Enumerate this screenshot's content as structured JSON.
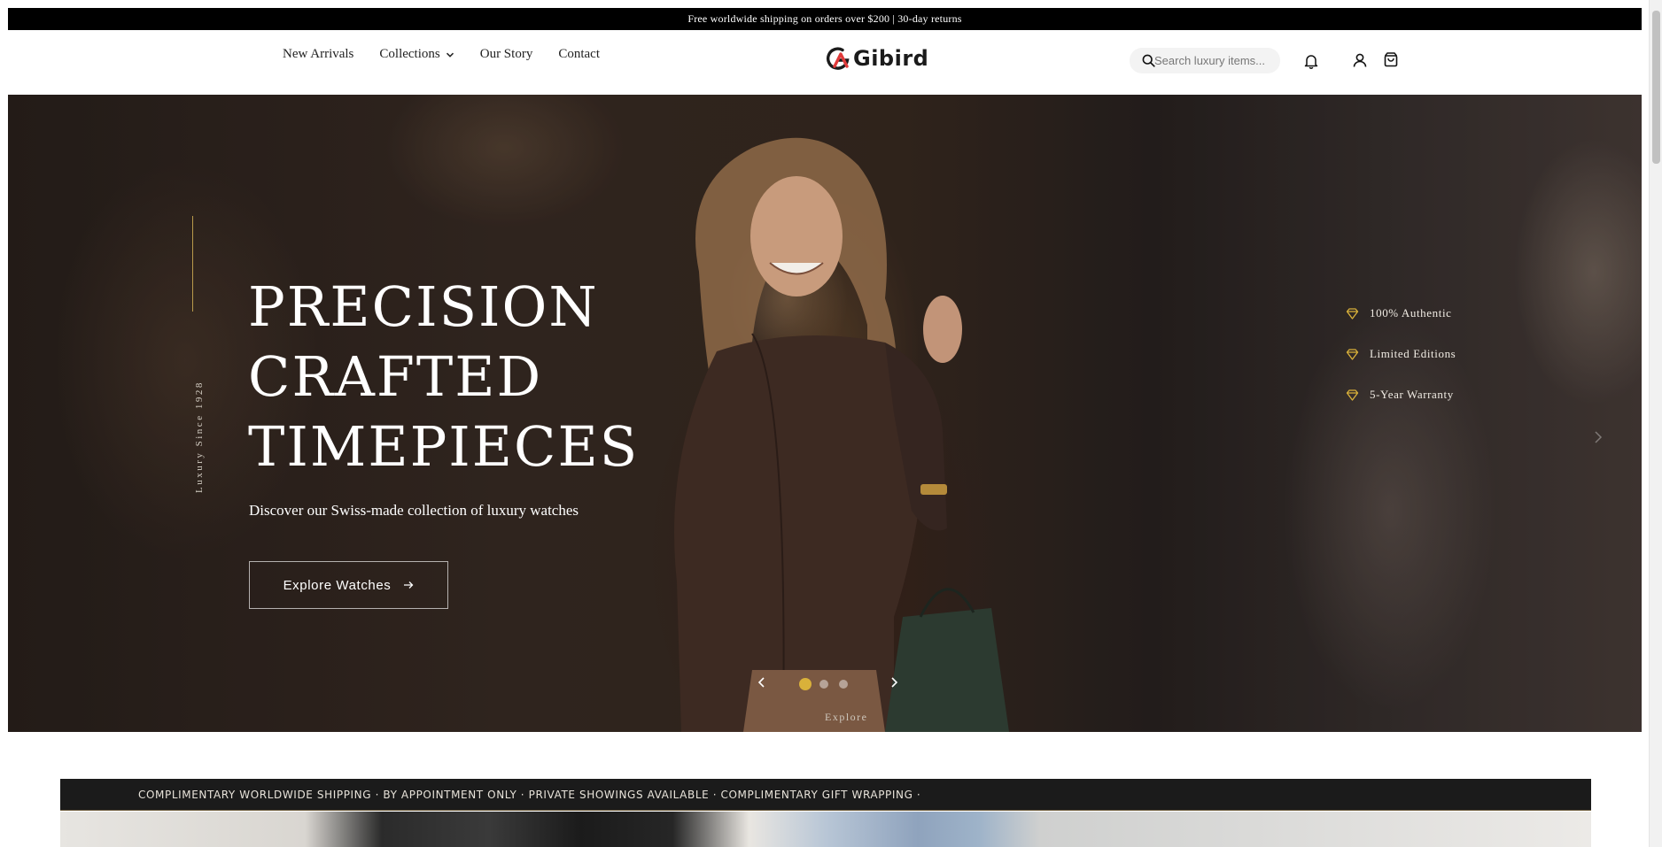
{
  "announcement": "Free worldwide shipping on orders over $200 | 30-day returns",
  "nav": {
    "items": [
      {
        "label": "New Arrivals"
      },
      {
        "label": "Collections"
      },
      {
        "label": "Our Story"
      },
      {
        "label": "Contact"
      }
    ]
  },
  "brand": {
    "name": "Gibird",
    "accent": "#e03a3a"
  },
  "search": {
    "placeholder": "Search luxury items..."
  },
  "header_icons": [
    "bell-icon",
    "user-icon",
    "shopping-bag-icon"
  ],
  "hero": {
    "side_text": "Luxury Since 1928",
    "title_lines": [
      "PRECISION",
      "CRAFTED",
      "TIMEPIECES"
    ],
    "subtitle": "Discover our Swiss-made collection of luxury watches",
    "cta_label": "Explore Watches",
    "features": [
      {
        "label": "100% Authentic",
        "icon": "diamond-icon"
      },
      {
        "label": "Limited Editions",
        "icon": "diamond-icon"
      },
      {
        "label": "5-Year Warranty",
        "icon": "diamond-icon"
      }
    ],
    "slides": {
      "count": 3,
      "active": 1
    },
    "scroll_hint": "Explore",
    "accent_gold": "#d9b13a"
  },
  "marquee": {
    "text": "COMPLIMENTARY WORLDWIDE SHIPPING · BY APPOINTMENT ONLY · PRIVATE SHOWINGS AVAILABLE · COMPLIMENTARY GIFT WRAPPING ·"
  }
}
